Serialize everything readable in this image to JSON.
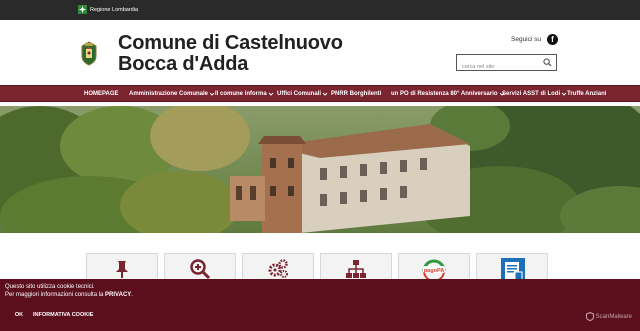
{
  "region": {
    "label": "Regione Lombardia"
  },
  "header": {
    "title_line1": "Comune di Castelnuovo",
    "title_line2": "Bocca d'Adda",
    "social_label": "Seguici su",
    "search_placeholder": "cerca nel sito"
  },
  "nav": [
    {
      "label": "HOMEPAGE",
      "dropdown": false
    },
    {
      "label": "Amministrazione Comunale",
      "dropdown": true
    },
    {
      "label": "Il comune informa",
      "dropdown": true
    },
    {
      "label": "Uffici Comunali",
      "dropdown": true
    },
    {
      "label": "PNRR Borghilenti",
      "dropdown": false
    },
    {
      "label": "un PO di Resistenza 80° Anniversario",
      "dropdown": true
    },
    {
      "label": "Servizi ASST di Lodi",
      "dropdown": true
    },
    {
      "label": "Truffe Anziani",
      "dropdown": false
    }
  ],
  "tiles": [
    {
      "icon": "pin-icon"
    },
    {
      "icon": "zoom-in-icon"
    },
    {
      "icon": "gears-icon"
    },
    {
      "icon": "sitemap-icon"
    },
    {
      "icon": "pagopa-icon",
      "text": "pagoPA"
    },
    {
      "icon": "document-badge-icon"
    }
  ],
  "cookie": {
    "line1": "Questo sito utilizza cookie tecnici.",
    "line2_prefix": "Per maggiori informazioni consulta la ",
    "line2_link": "PRIVACY",
    "line2_suffix": ".",
    "ok_label": "OK",
    "info_label": "INFORMATIVA COOKIE",
    "scanner_label": "ScanMalware"
  },
  "colors": {
    "topbar": "#2a2a2a",
    "nav": "#7a2430",
    "cookie_banner": "#5b0f1d",
    "icon": "#7a2430"
  }
}
